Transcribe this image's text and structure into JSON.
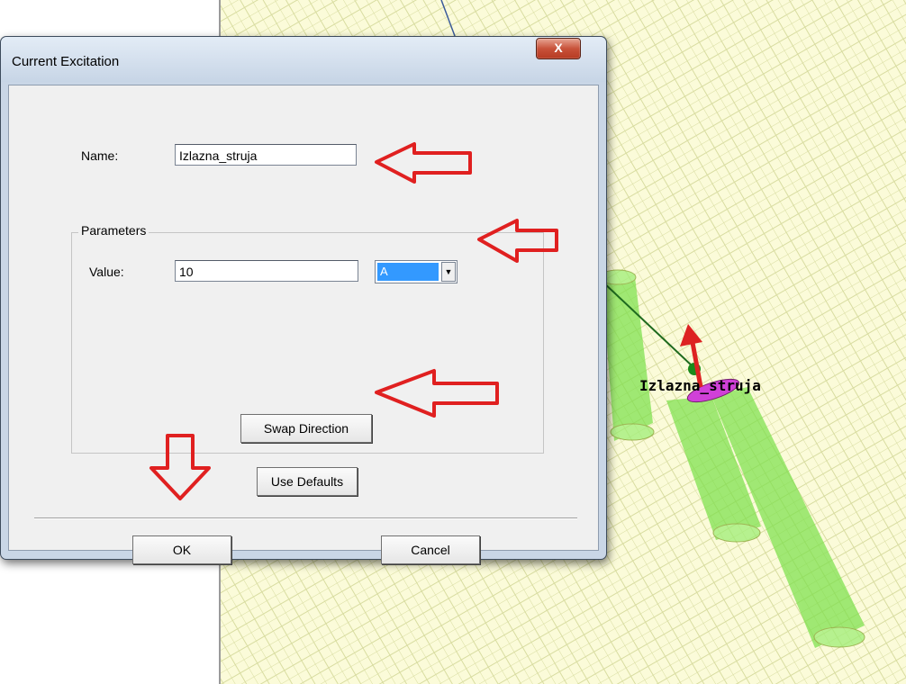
{
  "dialog": {
    "title": "Current Excitation",
    "close_glyph": "X",
    "name_label": "Name:",
    "name_value": "Izlazna_struja",
    "group_label": "Parameters",
    "value_label": "Value:",
    "value": "10",
    "unit_selected": "A",
    "swap_label": "Swap Direction",
    "defaults_label": "Use Defaults",
    "ok_label": "OK",
    "cancel_label": "Cancel"
  },
  "viewport": {
    "annotation": "Izlazna_struja"
  },
  "colors": {
    "grid_bg": "#fbfbd9",
    "grid_line": "#d8dca0",
    "cylinder_fill": "#79e048",
    "port_fill": "#d040d8",
    "arrow_red": "#dd2222",
    "selection_blue": "#3399ff"
  },
  "icons": [
    "close-icon",
    "dropdown-arrow-icon",
    "direction-arrow-icon"
  ]
}
